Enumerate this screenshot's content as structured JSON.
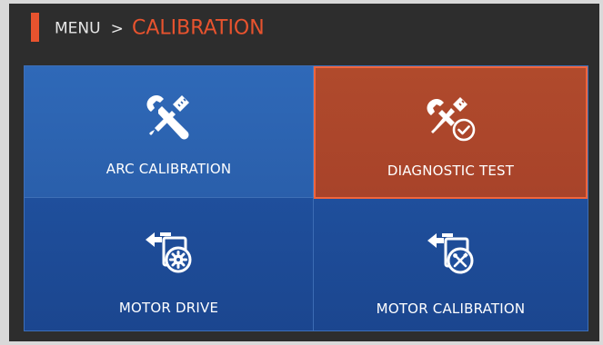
{
  "header": {
    "parent": "MENU",
    "separator": ">",
    "title": "CALIBRATION"
  },
  "tiles": [
    {
      "label": "ARC CALIBRATION",
      "icon": "wrench-screwdriver-icon",
      "selected": false
    },
    {
      "label": "DIAGNOSTIC TEST",
      "icon": "tools-check-icon",
      "selected": true
    },
    {
      "label": "MOTOR DRIVE",
      "icon": "motor-gear-icon",
      "selected": false
    },
    {
      "label": "MOTOR CALIBRATION",
      "icon": "motor-tools-icon",
      "selected": false
    }
  ],
  "colors": {
    "accent": "#e8532e",
    "tile_blue": "#2a5fab",
    "tile_selected": "#a8432a",
    "background": "#2d2d2d"
  }
}
